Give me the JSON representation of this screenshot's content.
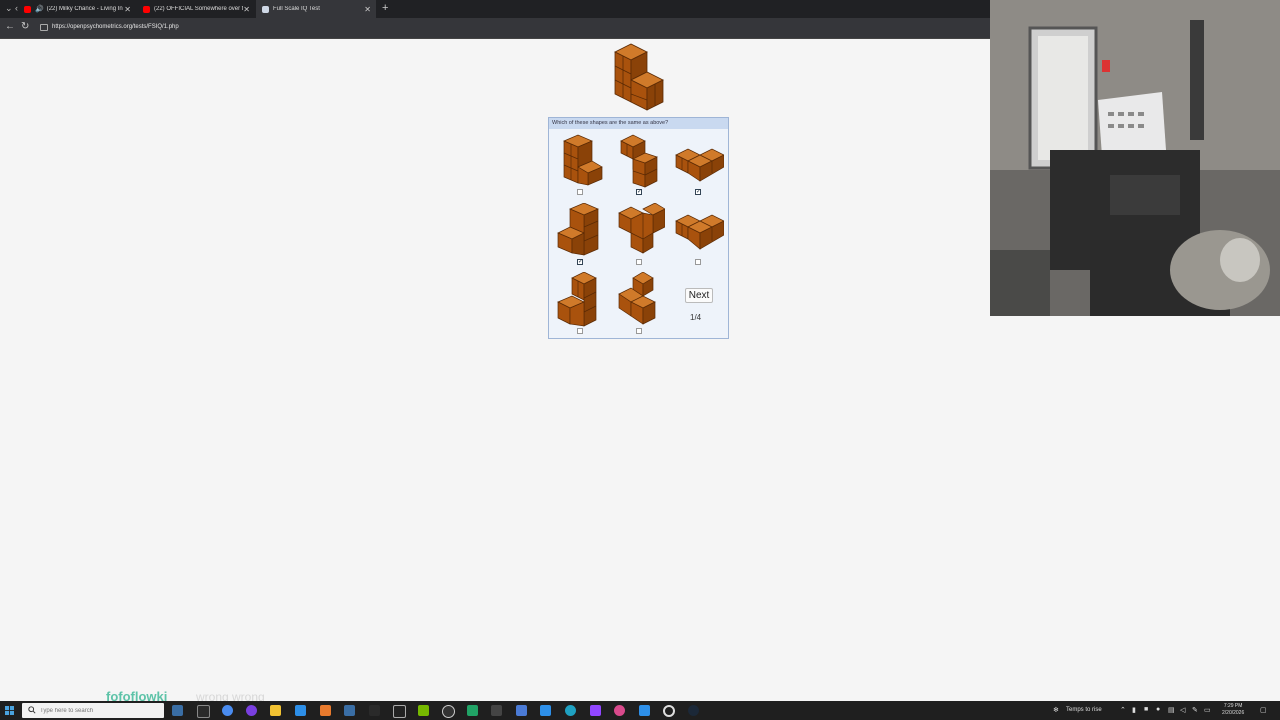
{
  "browser": {
    "tabs": [
      {
        "title": "(22) Milky Chance - Living In",
        "favicon_color": "#ff0000",
        "audio": true,
        "active": false
      },
      {
        "title": "(22) OFFICIAL Somewhere over th",
        "favicon_color": "#ff0000",
        "audio": false,
        "active": false
      },
      {
        "title": "Full Scale IQ Test",
        "favicon_color": "#cfd8e6",
        "audio": false,
        "active": true
      }
    ],
    "url": "https://openpsychometrics.org/tests/FSIQ/1.php"
  },
  "quiz": {
    "question": "Which of these shapes are the same as above?",
    "options": [
      {
        "id": "opt-1",
        "checked": false
      },
      {
        "id": "opt-2",
        "checked": true
      },
      {
        "id": "opt-3",
        "checked": true
      },
      {
        "id": "opt-4",
        "checked": true
      },
      {
        "id": "opt-5",
        "checked": false
      },
      {
        "id": "opt-6",
        "checked": false
      },
      {
        "id": "opt-7",
        "checked": false
      },
      {
        "id": "opt-8",
        "checked": false
      }
    ],
    "next_label": "Next",
    "progress": "1/4",
    "block_color": "#b3580f"
  },
  "overlay": {
    "name": "fofoflowki",
    "message": "wrong wrong"
  },
  "taskbar": {
    "search_placeholder": "Type here to search",
    "weather": "Temps to rise",
    "time": "7:29 PM",
    "date": "2/20/2026"
  }
}
